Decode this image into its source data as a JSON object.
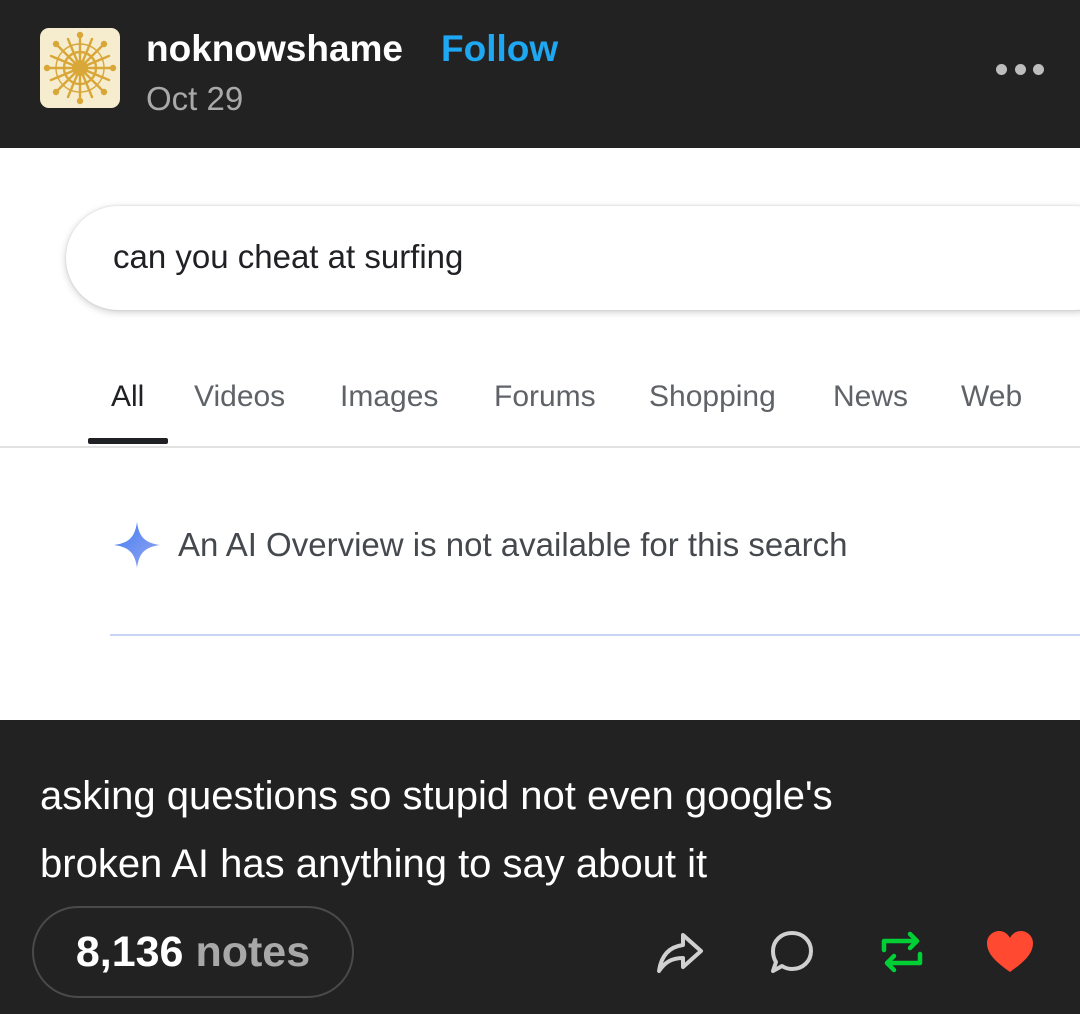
{
  "post": {
    "username": "noknowshame",
    "follow_label": "Follow",
    "date": "Oct 29",
    "caption_line1": "asking questions so stupid not even google's",
    "caption_line2": "broken AI has anything to say about it",
    "notes_count": "8,136",
    "notes_label": "notes"
  },
  "search_screenshot": {
    "query": "can you cheat at surfing",
    "tabs": [
      "All",
      "Videos",
      "Images",
      "Forums",
      "Shopping",
      "News",
      "Web"
    ],
    "active_tab": "All",
    "ai_overview_message": "An AI Overview is not available for this search"
  },
  "icons": {
    "more": "more-options-icon",
    "share": "share-icon",
    "reply": "reply-icon",
    "reblog": "reblog-icon",
    "like": "heart-icon",
    "sparkle": "ai-sparkle-icon"
  },
  "colors": {
    "background": "#222222",
    "follow": "#1ea7f2",
    "reblog": "#00cf35",
    "like": "#ff4930",
    "sparkle": "#4a86f5"
  }
}
